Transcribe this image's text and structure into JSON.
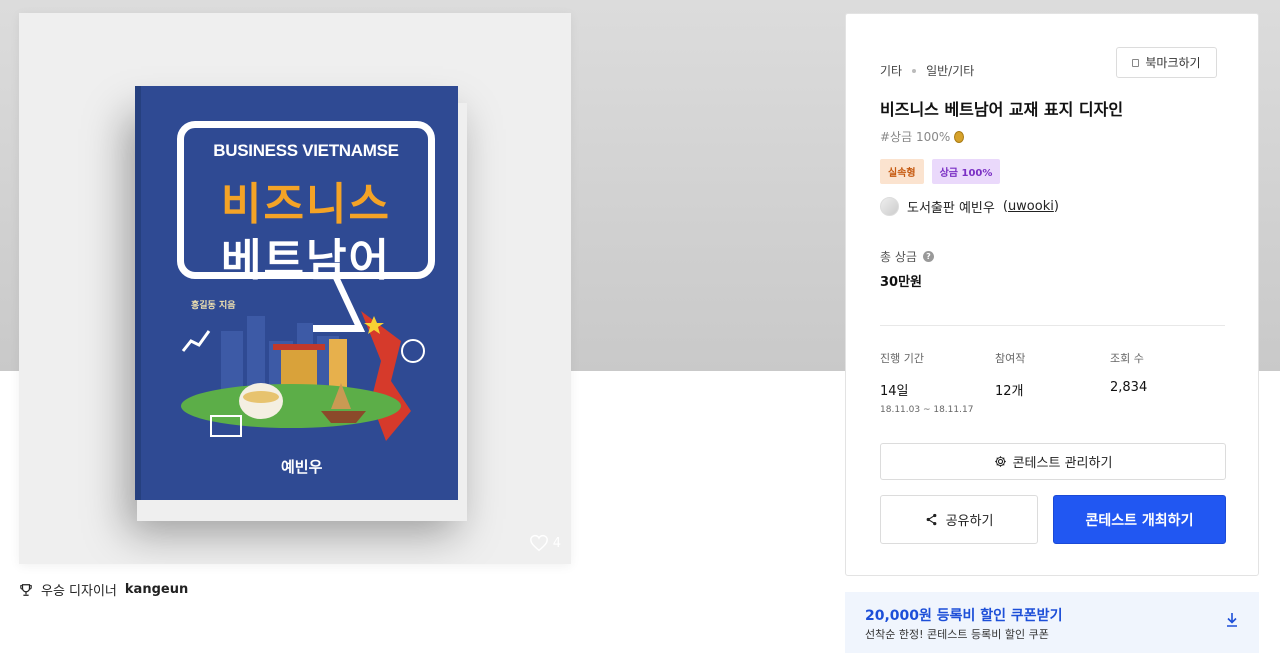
{
  "book": {
    "subtitle": "BUSINESS VIETNAMSE",
    "title_line1": "비즈니스",
    "title_line2": "베트남어",
    "author": "홍길동 지음",
    "publisher": "예빈우"
  },
  "image": {
    "like_count": "4"
  },
  "award": {
    "label": "우승 디자이너",
    "designer": "kangeun"
  },
  "panel": {
    "breadcrumb": [
      "기타",
      "일반/기타"
    ],
    "bookmark_label": "북마크하기",
    "title": "비즈니스 베트남어 교재 표지 디자인",
    "tagline": "#상금 100%",
    "badges": [
      "실속형",
      "상금 100%"
    ],
    "host_name": "도서출판 예빈우",
    "host_id": "uwooki",
    "prize_label": "총 상금",
    "prize_value": "30만원",
    "stats": {
      "period_label": "진행 기간",
      "period_value": "14일",
      "period_range": "18.11.03 ~ 18.11.17",
      "participants_label": "참여작",
      "participants_value": "12개",
      "views_label": "조회 수",
      "views_value": "2,834"
    },
    "manage_label": "콘테스트 관리하기",
    "share_label": "공유하기",
    "host_contest_label": "콘테스트 개최하기"
  },
  "coupon": {
    "headline": "20,000원 등록비 할인 쿠폰받기",
    "sub": "선착순 한정! 콘테스트 등록비 할인 쿠폰"
  },
  "colors": {
    "primary": "#2157f2",
    "coupon_text": "#1d4fd8",
    "book_blue": "#2f4a93",
    "book_orange": "#f4a326"
  }
}
